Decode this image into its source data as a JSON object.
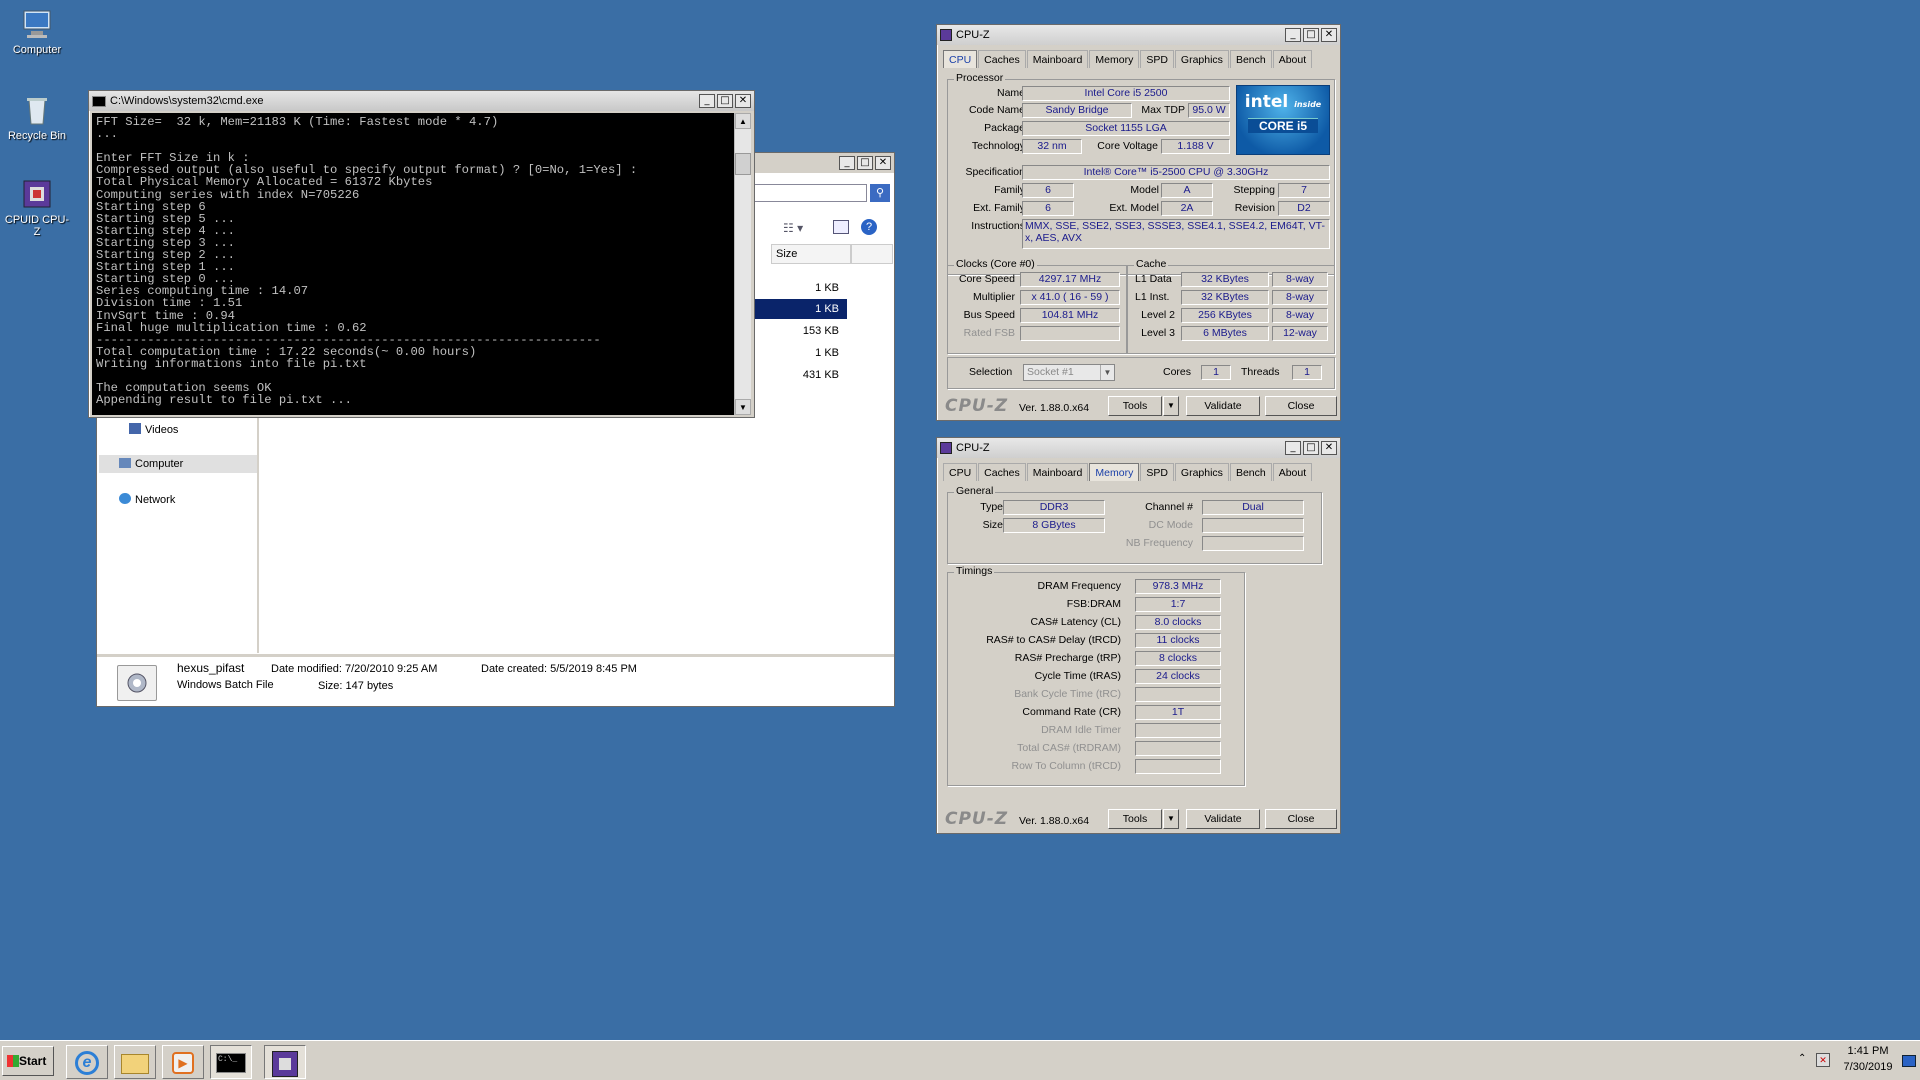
{
  "desktop": {
    "icons": [
      {
        "label": "Computer"
      },
      {
        "label": "Recycle Bin"
      },
      {
        "label": "CPUID CPU-Z"
      }
    ]
  },
  "cmd": {
    "title": "C:\\Windows\\system32\\cmd.exe",
    "lines": [
      "FFT Size=  32 k, Mem=21183 K (Time: Fastest mode * 4.7)",
      "...",
      "",
      "Enter FFT Size in k :",
      "Compressed output (also useful to specify output format) ? [0=No, 1=Yes] :",
      "Total Physical Memory Allocated = 61372 Kbytes",
      "Computing series with index N=705226",
      "Starting step 6",
      "Starting step 5 ...",
      "Starting step 4 ...",
      "Starting step 3 ...",
      "Starting step 2 ...",
      "Starting step 1 ...",
      "Starting step 0 ...",
      "Series computing time : 14.07",
      "Division time : 1.51",
      "InvSqrt time : 0.94",
      "Final huge multiplication time : 0.62",
      "---------------------------------------------------------------------",
      "Total computation time : 17.22 seconds(~ 0.00 hours)",
      "Writing informations into file pi.txt",
      "",
      "The computation seems OK",
      "Appending result to file pi.txt ..."
    ]
  },
  "explorer": {
    "column_size": "Size",
    "sizes": [
      "1 KB",
      "1 KB",
      "153 KB",
      "1 KB",
      "431 KB"
    ],
    "nav": [
      {
        "label": "Videos"
      },
      {
        "label": "Computer"
      },
      {
        "label": "Network"
      }
    ],
    "details": {
      "name": "hexus_pifast",
      "type": "Windows Batch File",
      "modified_label": "Date modified:",
      "modified": "7/20/2010 9:25 AM",
      "created_label": "Date created:",
      "created": "5/5/2019 8:45 PM",
      "size_label": "Size:",
      "size": "147 bytes"
    }
  },
  "cpuz_tabs": [
    "CPU",
    "Caches",
    "Mainboard",
    "Memory",
    "SPD",
    "Graphics",
    "Bench",
    "About"
  ],
  "cpuz1": {
    "title": "CPU-Z",
    "processor_group": "Processor",
    "name_label": "Name",
    "name": "Intel Core i5 2500",
    "codename_label": "Code Name",
    "codename": "Sandy Bridge",
    "maxtdp_label": "Max TDP",
    "maxtdp": "95.0 W",
    "package_label": "Package",
    "package": "Socket 1155 LGA",
    "technology_label": "Technology",
    "technology": "32 nm",
    "corevoltage_label": "Core Voltage",
    "corevoltage": "1.188 V",
    "spec_label": "Specification",
    "spec": "Intel® Core™ i5-2500 CPU @ 3.30GHz",
    "family_label": "Family",
    "family": "6",
    "model_label": "Model",
    "model": "A",
    "stepping_label": "Stepping",
    "stepping": "7",
    "extfamily_label": "Ext. Family",
    "extfamily": "6",
    "extmodel_label": "Ext. Model",
    "extmodel": "2A",
    "revision_label": "Revision",
    "revision": "D2",
    "instructions_label": "Instructions",
    "instructions": "MMX, SSE, SSE2, SSE3, SSSE3, SSE4.1, SSE4.2, EM64T, VT-x, AES, AVX",
    "clocks_group": "Clocks (Core #0)",
    "corespeed_label": "Core Speed",
    "corespeed": "4297.17 MHz",
    "multiplier_label": "Multiplier",
    "multiplier": "x 41.0 ( 16 - 59 )",
    "busspeed_label": "Bus Speed",
    "busspeed": "104.81 MHz",
    "ratedfsb_label": "Rated FSB",
    "cache_group": "Cache",
    "l1d_label": "L1 Data",
    "l1d": "32 KBytes",
    "l1d_way": "8-way",
    "l1i_label": "L1 Inst.",
    "l1i": "32 KBytes",
    "l1i_way": "8-way",
    "l2_label": "Level 2",
    "l2": "256 KBytes",
    "l2_way": "8-way",
    "l3_label": "Level 3",
    "l3": "6 MBytes",
    "l3_way": "12-way",
    "selection_label": "Selection",
    "selection": "Socket #1",
    "cores_label": "Cores",
    "cores": "1",
    "threads_label": "Threads",
    "threads": "1",
    "logo_text": "CPU-Z",
    "version": "Ver. 1.88.0.x64",
    "tools": "Tools",
    "validate": "Validate",
    "close": "Close",
    "intel_inside": "intel",
    "intel_sub": "inside",
    "intel_core": "CORE i5"
  },
  "cpuz2": {
    "title": "CPU-Z",
    "general_group": "General",
    "type_label": "Type",
    "type": "DDR3",
    "size_label": "Size",
    "size": "8 GBytes",
    "channel_label": "Channel #",
    "channel": "Dual",
    "dcmode_label": "DC Mode",
    "nbfreq_label": "NB Frequency",
    "timings_group": "Timings",
    "dram_label": "DRAM Frequency",
    "dram": "978.3 MHz",
    "fsb_label": "FSB:DRAM",
    "fsb": "1:7",
    "cas_label": "CAS# Latency (CL)",
    "cas": "8.0 clocks",
    "rcd_label": "RAS# to CAS# Delay (tRCD)",
    "rcd": "11 clocks",
    "rp_label": "RAS# Precharge (tRP)",
    "rp": "8 clocks",
    "ras_label": "Cycle Time (tRAS)",
    "ras": "24 clocks",
    "rc_label": "Bank Cycle Time (tRC)",
    "cr_label": "Command Rate (CR)",
    "cr": "1T",
    "idle_label": "DRAM Idle Timer",
    "rdram_label": "Total CAS# (tRDRAM)",
    "rtc_label": "Row To Column (tRCD)",
    "logo_text": "CPU-Z",
    "version": "Ver. 1.88.0.x64",
    "tools": "Tools",
    "validate": "Validate",
    "close": "Close"
  },
  "taskbar": {
    "start": "Start",
    "time": "1:41 PM",
    "date": "7/30/2019"
  }
}
